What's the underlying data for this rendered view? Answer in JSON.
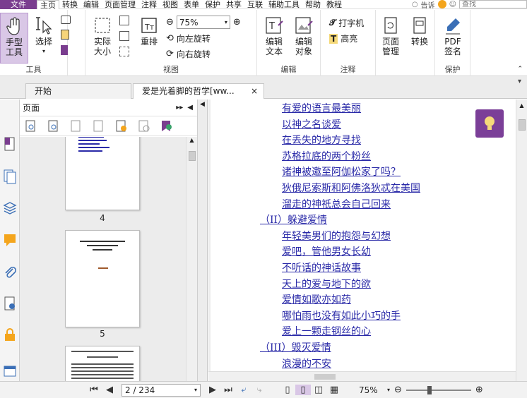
{
  "menu": {
    "file": "文件",
    "items": [
      "主页",
      "转换",
      "编辑",
      "页面管理",
      "注释",
      "视图",
      "表单",
      "保护",
      "共享",
      "互联",
      "辅助工具",
      "帮助",
      "教程"
    ],
    "tell_me": "告诉",
    "search_placeholder": "查找"
  },
  "ribbon": {
    "tools_group": "工具",
    "hand_tool": "手型\n工具",
    "select": "选择",
    "view_group": "视图",
    "actual_size": "实际\n大小",
    "reflow": "重排",
    "zoom_value": "75%",
    "rotate_left": "向左旋转",
    "rotate_right": "向右旋转",
    "edit_group": "编辑",
    "edit_text": "编辑\n文本",
    "edit_object": "编辑\n对象",
    "annot_group": "注释",
    "typewriter": "打字机",
    "highlight": "高亮",
    "page_mgmt": "页面\n管理",
    "convert": "转换",
    "protect_group": "保护",
    "pdf_sign": "PDF\n签名"
  },
  "tabs": [
    {
      "label": "开始"
    },
    {
      "label": "爱是光着脚的哲学[ww...",
      "close": "×"
    }
  ],
  "panel": {
    "title": "页面",
    "thumbnails": [
      {
        "page": "4"
      },
      {
        "page": "5"
      }
    ]
  },
  "toc": [
    "有爱的语言最美丽",
    "以神之名谈爱",
    "在丢失的地方寻找",
    "苏格拉底的两个粉丝",
    "诸神被邀至阿伽松家了吗？",
    "狄俄尼索斯和阿佛洛狄忒在美国",
    "溜走的神祇总会自己回来",
    "（II）躲避爱情",
    "年轻美男们的抱怨与幻想",
    "爱吧，管他男女长幼",
    "不听话的神话故事",
    "天上的爱与地下的欲",
    "爱情如歌亦如药",
    "哪怕雨也没有如此小巧的手",
    "爱上一颗走钢丝的心",
    "（III）毁灭爱情",
    "浪漫的不安"
  ],
  "toc_indent": [
    1,
    1,
    1,
    1,
    1,
    1,
    1,
    0,
    1,
    1,
    1,
    1,
    1,
    1,
    1,
    0,
    1
  ],
  "status": {
    "page_field": "2 / 234",
    "zoom": "75%"
  },
  "colors": {
    "accent": "#7a3d8f",
    "link": "#2a2aa8",
    "hand_bg": "#d9c7e6"
  }
}
